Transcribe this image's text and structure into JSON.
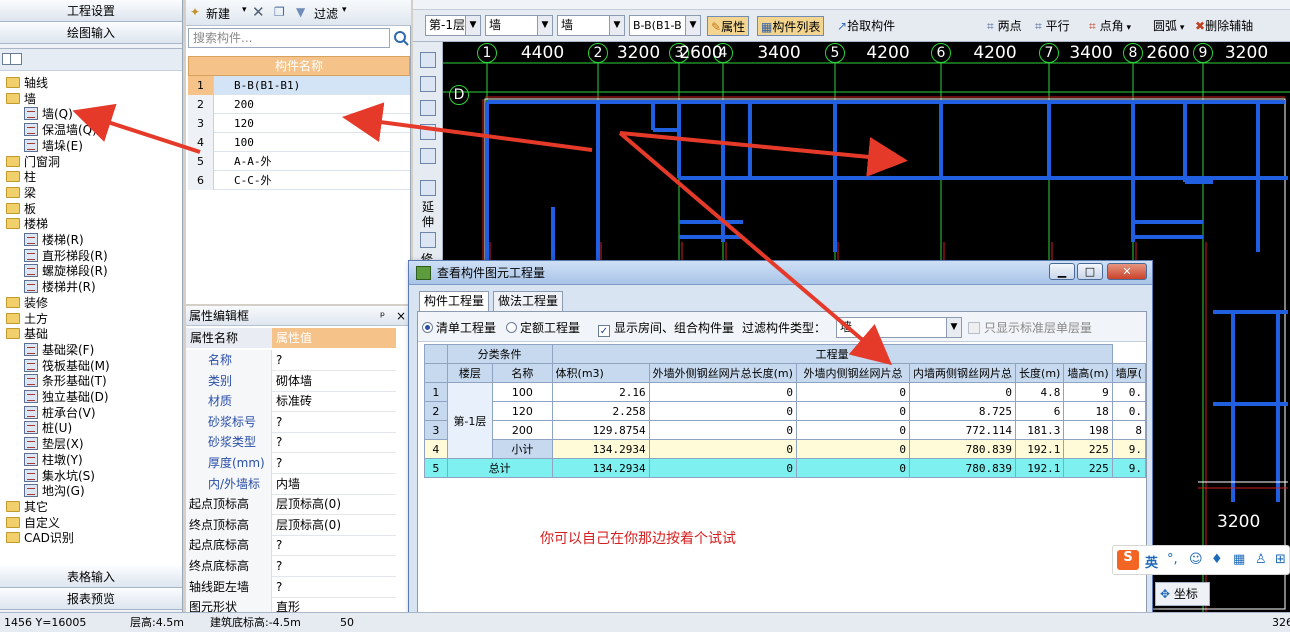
{
  "left_nav": {
    "top_buttons": [
      "工程设置",
      "绘图输入"
    ],
    "bottom_buttons": [
      "表格输入",
      "报表预览"
    ],
    "tree": [
      {
        "label": "轴线",
        "type": "folder",
        "indent": 0
      },
      {
        "label": "墙",
        "type": "folder",
        "indent": 0
      },
      {
        "label": "墙(Q)",
        "type": "leaf",
        "indent": 1
      },
      {
        "label": "保温墙(Q)",
        "type": "leaf",
        "indent": 1
      },
      {
        "label": "墙垛(E)",
        "type": "leaf",
        "indent": 1
      },
      {
        "label": "门窗洞",
        "type": "folder",
        "indent": 0
      },
      {
        "label": "柱",
        "type": "folder",
        "indent": 0
      },
      {
        "label": "梁",
        "type": "folder",
        "indent": 0
      },
      {
        "label": "板",
        "type": "folder",
        "indent": 0
      },
      {
        "label": "楼梯",
        "type": "folder",
        "indent": 0
      },
      {
        "label": "楼梯(R)",
        "type": "leaf",
        "indent": 1
      },
      {
        "label": "直形梯段(R)",
        "type": "leaf",
        "indent": 1
      },
      {
        "label": "螺旋梯段(R)",
        "type": "leaf",
        "indent": 1
      },
      {
        "label": "楼梯井(R)",
        "type": "leaf",
        "indent": 1
      },
      {
        "label": "装修",
        "type": "folder",
        "indent": 0
      },
      {
        "label": "土方",
        "type": "folder",
        "indent": 0
      },
      {
        "label": "基础",
        "type": "folder",
        "indent": 0
      },
      {
        "label": "基础梁(F)",
        "type": "leaf",
        "indent": 1
      },
      {
        "label": "筏板基础(M)",
        "type": "leaf",
        "indent": 1
      },
      {
        "label": "条形基础(T)",
        "type": "leaf",
        "indent": 1
      },
      {
        "label": "独立基础(D)",
        "type": "leaf",
        "indent": 1
      },
      {
        "label": "桩承台(V)",
        "type": "leaf",
        "indent": 1
      },
      {
        "label": "桩(U)",
        "type": "leaf",
        "indent": 1
      },
      {
        "label": "垫层(X)",
        "type": "leaf",
        "indent": 1
      },
      {
        "label": "柱墩(Y)",
        "type": "leaf",
        "indent": 1
      },
      {
        "label": "集水坑(S)",
        "type": "leaf",
        "indent": 1
      },
      {
        "label": "地沟(G)",
        "type": "leaf",
        "indent": 1
      },
      {
        "label": "其它",
        "type": "folder",
        "indent": 0
      },
      {
        "label": "自定义",
        "type": "folder",
        "indent": 0
      },
      {
        "label": "CAD识别",
        "type": "folder",
        "indent": 0
      }
    ]
  },
  "component_list": {
    "toolbar": {
      "new": "新建",
      "filter": "过滤"
    },
    "search_placeholder": "搜索构件...",
    "header": "构件名称",
    "rows": [
      "B-B(B1-B1)",
      "200",
      "120",
      "100",
      "A-A-外",
      "C-C-外"
    ]
  },
  "properties": {
    "title": "属性编辑框",
    "pin": "ᵖ",
    "close": "×",
    "col_name": "属性名称",
    "col_value": "属性值",
    "rows": [
      {
        "k": "名称",
        "v": "?"
      },
      {
        "k": "类别",
        "v": "砌体墙"
      },
      {
        "k": "材质",
        "v": "标准砖"
      },
      {
        "k": "砂浆标号",
        "v": "?"
      },
      {
        "k": "砂浆类型",
        "v": "?"
      },
      {
        "k": "厚度(mm)",
        "v": "?"
      },
      {
        "k": "内/外墙标",
        "v": "内墙"
      },
      {
        "k": "起点顶标高",
        "v": "层顶标高(0)"
      },
      {
        "k": "终点顶标高",
        "v": "层顶标高(0)"
      },
      {
        "k": "起点底标高",
        "v": "?"
      },
      {
        "k": "终点底标高",
        "v": "?"
      },
      {
        "k": "轴线距左墙",
        "v": "?"
      },
      {
        "k": "图元形状",
        "v": "直形"
      }
    ]
  },
  "toolbar2": {
    "floor": "第-1层",
    "type1": "墙",
    "type2": "墙",
    "component": "B-B(B1-B",
    "btn_attr": "属性",
    "btn_list": "构件列表",
    "btn_pick": "拾取构件",
    "btn_twopoint": "两点",
    "btn_parallel": "平行",
    "btn_pointangle": "点角",
    "btn_arc": "圆弧",
    "btn_delaux": "删除辅轴",
    "tool_extend": "延伸",
    "tool_modify": "修"
  },
  "cad": {
    "axis_numbers": [
      "1",
      "2",
      "3",
      "4",
      "5",
      "6",
      "7",
      "8",
      "9"
    ],
    "dimensions": [
      "4400",
      "3200",
      "2600",
      "3400",
      "4200",
      "4200",
      "3400",
      "2600",
      "3200"
    ],
    "row_label": "D",
    "bottom_dim": "3200",
    "colors": {
      "wall": "#1f5fe0",
      "axis": "#d02020",
      "grid": "#2fd23a",
      "background": "#000000"
    }
  },
  "dialog": {
    "title": "查看构件图元工程量",
    "tabs": [
      "构件工程量",
      "做法工程量"
    ],
    "radio_bill": "清单工程量",
    "radio_quota": "定额工程量",
    "show_rooms": "显示房间、组合构件量",
    "filter_label": "过滤构件类型：",
    "filter_value": "墙",
    "only_std": "只显示标准层单层量",
    "group_header": "分类条件",
    "qty_header": "工程量",
    "columns": [
      "楼层",
      "名称",
      "体积(m3)",
      "外墙外侧钢丝网片总长度(m)",
      "外墙内侧钢丝网片总",
      "内墙两侧钢丝网片总",
      "长度(m)",
      "墙高(m)",
      "墙厚("
    ],
    "floor": "第-1层",
    "rows": [
      {
        "n": "1",
        "name": "100",
        "vol": "2.16",
        "a": "0",
        "b": "0",
        "c": "0",
        "len": "4.8",
        "h": "9",
        "t": "0."
      },
      {
        "n": "2",
        "name": "120",
        "vol": "2.258",
        "a": "0",
        "b": "0",
        "c": "8.725",
        "len": "6",
        "h": "18",
        "t": "0."
      },
      {
        "n": "3",
        "name": "200",
        "vol": "129.8754",
        "a": "0",
        "b": "0",
        "c": "772.114",
        "len": "181.3",
        "h": "198",
        "t": "8"
      },
      {
        "n": "4",
        "name": "小计",
        "vol": "134.2934",
        "a": "0",
        "b": "0",
        "c": "780.839",
        "len": "192.1",
        "h": "225",
        "t": "9."
      },
      {
        "n": "5",
        "name": "总计",
        "vol": "134.2934",
        "a": "0",
        "b": "0",
        "c": "780.839",
        "len": "192.1",
        "h": "225",
        "t": "9."
      }
    ]
  },
  "annotation": "你可以自己在你那边按着个试试",
  "ime": {
    "lang": "英",
    "coord_btn": "坐标"
  },
  "status": {
    "coord": "1456 Y=16005",
    "floor_h": "层高:4.5m",
    "base_elev": "建筑底标高:-4.5m",
    "num": "50",
    "right": "326"
  }
}
